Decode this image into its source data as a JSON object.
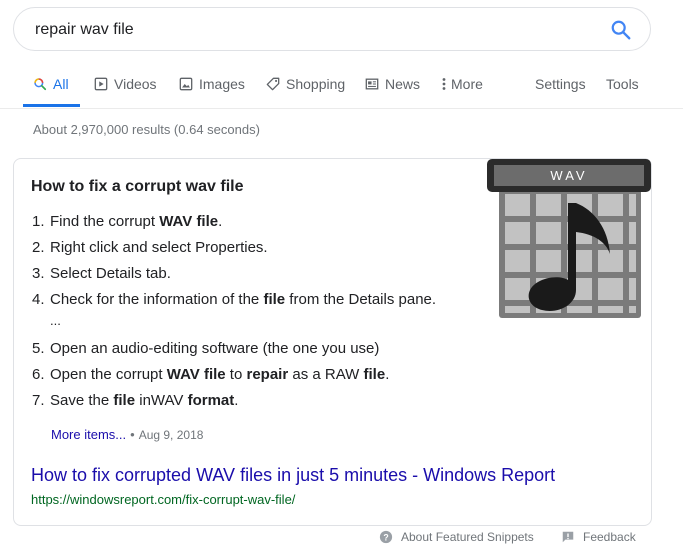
{
  "search": {
    "query": "repair wav file"
  },
  "tabs": [
    {
      "label": "All",
      "icon": "search-icon",
      "active": true
    },
    {
      "label": "Videos",
      "icon": "video-icon"
    },
    {
      "label": "Images",
      "icon": "image-icon"
    },
    {
      "label": "Shopping",
      "icon": "tag-icon"
    },
    {
      "label": "News",
      "icon": "news-icon"
    },
    {
      "label": "More",
      "icon": "more-vertical-icon"
    }
  ],
  "tools": {
    "settings": "Settings",
    "tools": "Tools"
  },
  "stats": "About 2,970,000 results (0.64 seconds)",
  "snippet": {
    "title_parts": [
      "How to ",
      "fix",
      " a corrupt ",
      "wav file"
    ],
    "steps": [
      {
        "num": "1.",
        "parts": [
          "Find the corrupt ",
          "WAV file",
          "."
        ]
      },
      {
        "num": "2.",
        "parts": [
          "Right click and select Properties."
        ]
      },
      {
        "num": "3.",
        "parts": [
          "Select Details tab."
        ]
      },
      {
        "num": "4.",
        "parts": [
          "Check for the information of the ",
          "file",
          " from the Details pane."
        ]
      },
      {
        "num": "5.",
        "parts": [
          "Open an audio-editing software (the one you use)"
        ]
      },
      {
        "num": "6.",
        "parts": [
          "Open the corrupt ",
          "WAV file",
          " to ",
          "repair",
          " as a RAW ",
          "file",
          "."
        ]
      },
      {
        "num": "7.",
        "parts": [
          "Save the ",
          "file",
          " inWAV ",
          "format",
          "."
        ]
      }
    ],
    "ellipsis": "...",
    "more_items": "More items...",
    "separator": "•",
    "date": "Aug 9, 2018",
    "image_label": "WAV",
    "image_icon": "wav-file-icon"
  },
  "result": {
    "title": "How to fix corrupted WAV files in just 5 minutes - Windows Report",
    "url": "https://windowsreport.com/fix-corrupt-wav-file/"
  },
  "footer": {
    "about": "About Featured Snippets",
    "feedback": "Feedback"
  },
  "colors": {
    "accent": "#1a73e8",
    "link": "#1a0dab",
    "url": "#006621"
  }
}
